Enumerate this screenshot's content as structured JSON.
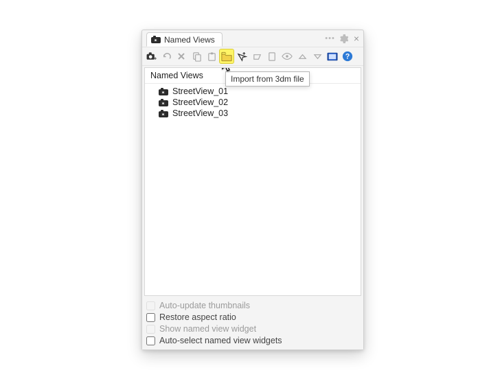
{
  "panel": {
    "tab_title": "Named Views",
    "toolbar_icons": [
      "save-view-icon",
      "undo-icon",
      "delete-icon",
      "copy-icon",
      "paste-icon",
      "import-icon",
      "cursor-target-icon",
      "restore-icon",
      "clipboard-icon",
      "eye-icon",
      "up-icon",
      "down-icon",
      "film-icon",
      "help-icon"
    ],
    "tooltip": "Import from 3dm file",
    "column_header": "Named Views",
    "items": [
      {
        "label": "StreetView_01"
      },
      {
        "label": "StreetView_02"
      },
      {
        "label": "StreetView_03"
      }
    ],
    "options": [
      {
        "label": "Auto-update thumbnails",
        "checked": false,
        "enabled": false
      },
      {
        "label": "Restore aspect ratio",
        "checked": false,
        "enabled": true
      },
      {
        "label": "Show named view widget",
        "checked": false,
        "enabled": false
      },
      {
        "label": "Auto-select named view widgets",
        "checked": false,
        "enabled": true
      }
    ]
  }
}
